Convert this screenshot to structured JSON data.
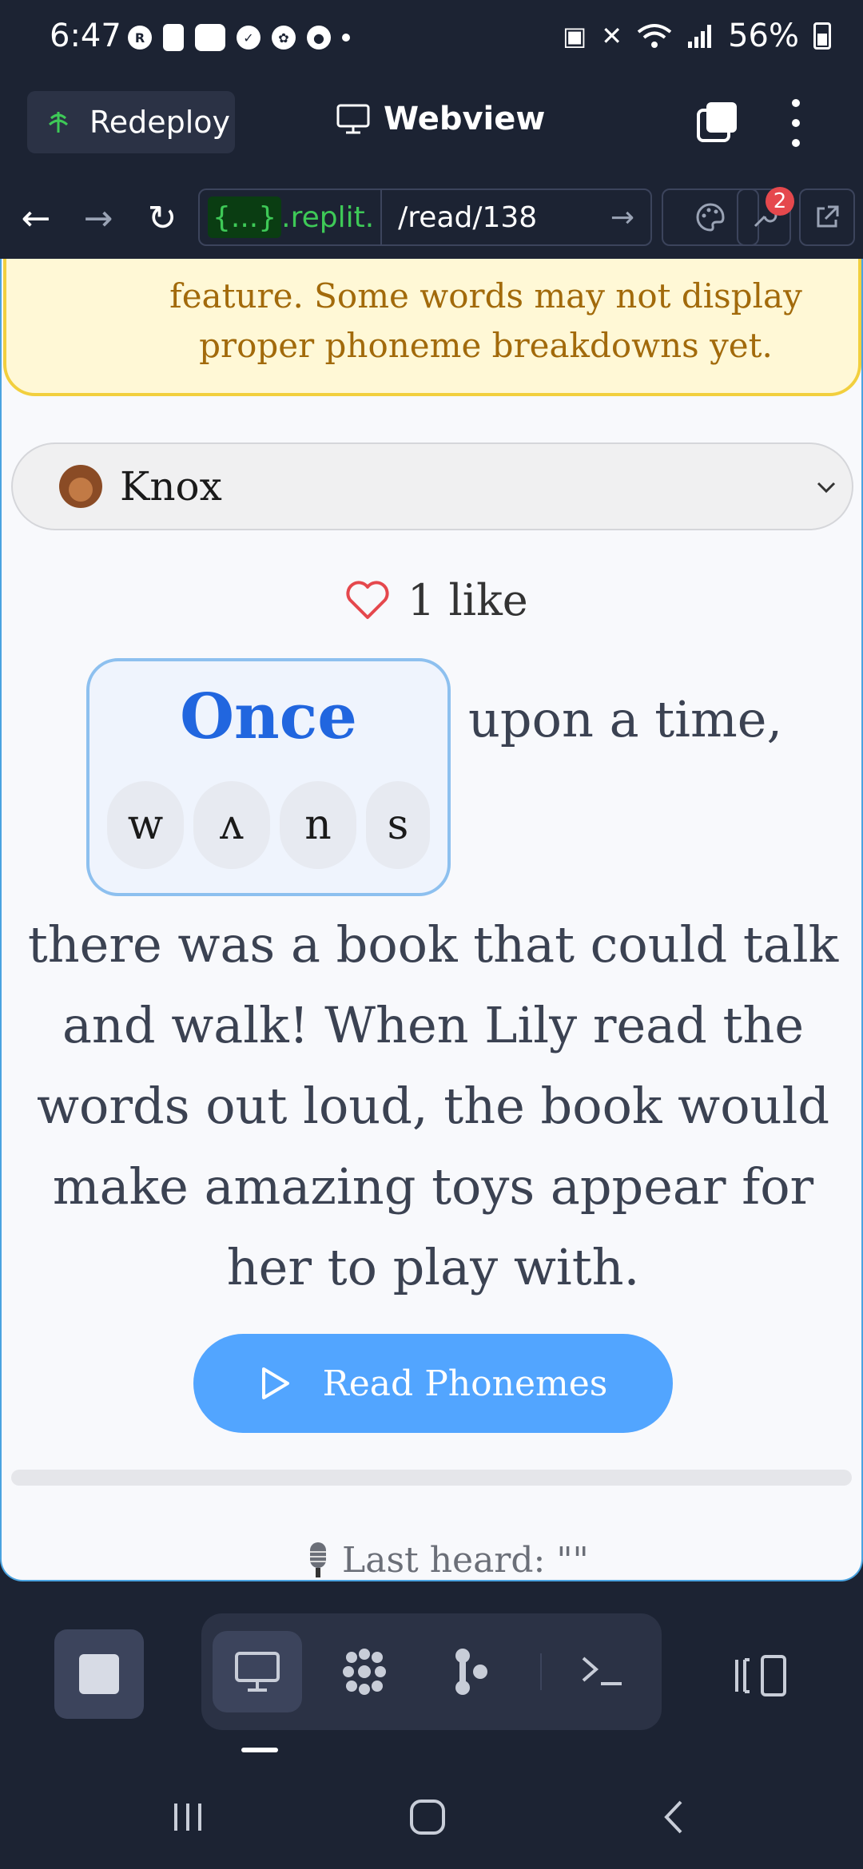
{
  "status_bar": {
    "time": "6:47",
    "battery": "56%"
  },
  "header": {
    "redeploy_label": "Redeploy",
    "webview_title": "Webview"
  },
  "url_bar": {
    "host": "{...}",
    "host_suffix": ".replit.",
    "path": "/read/138",
    "badge_count": "2"
  },
  "notice": {
    "text": "feature. Some words may not display proper phoneme breakdowns yet."
  },
  "profile": {
    "name": "Knox"
  },
  "likes": {
    "label": "1 like"
  },
  "word_card": {
    "word": "Once",
    "phonemes": [
      "w",
      "ʌ",
      "n",
      "s"
    ]
  },
  "story": {
    "first_line": "upon a time,",
    "body": "there was a book that could talk and walk! When Lily read the words out loud, the book would make amazing toys appear for her to play with."
  },
  "read_button": {
    "label": "Read Phonemes"
  },
  "last_heard": {
    "label": "Last heard: \"\""
  },
  "colors": {
    "accent": "#52a5ff",
    "word": "#2166df",
    "notice_bg": "#fff8d6",
    "like": "#e5484d"
  }
}
